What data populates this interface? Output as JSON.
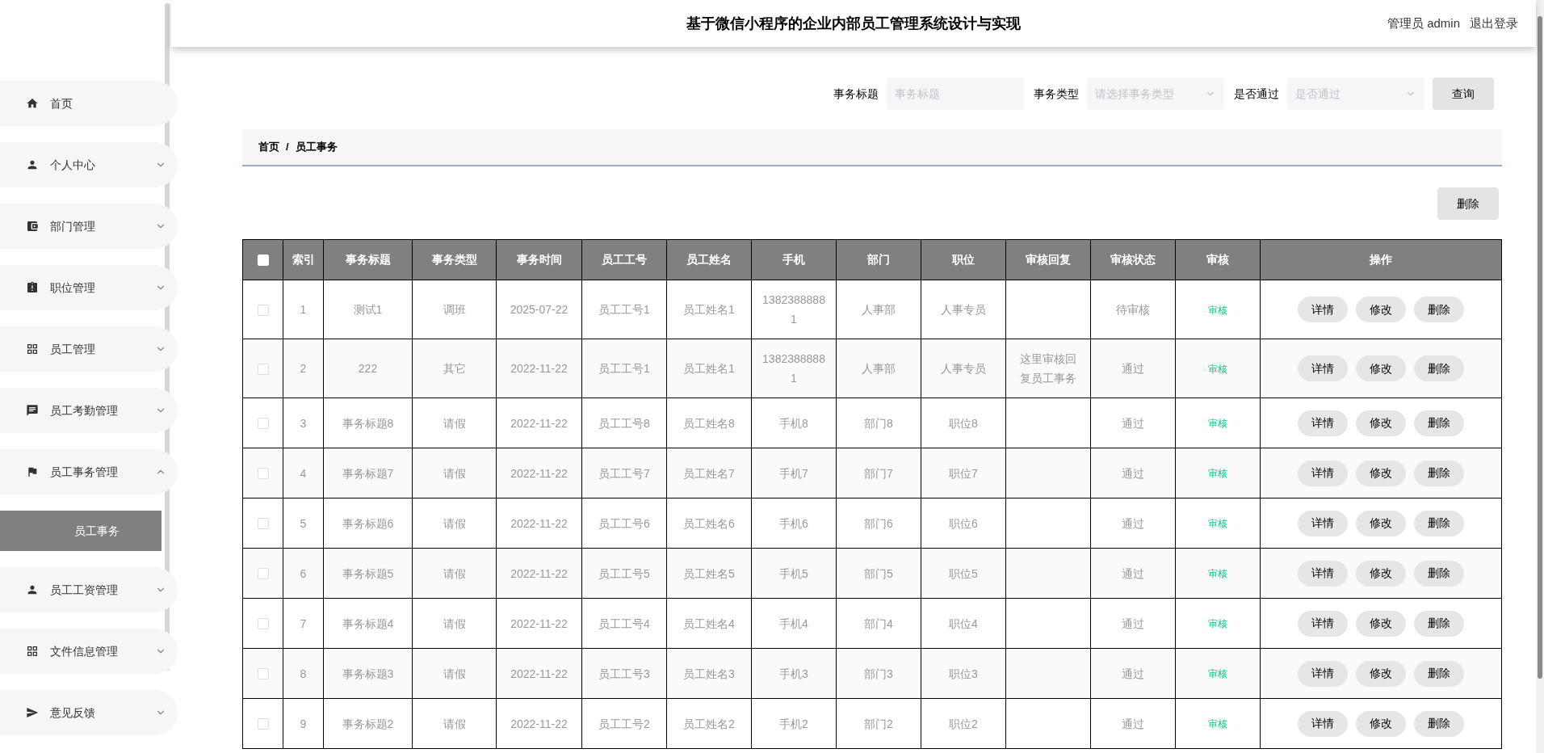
{
  "header": {
    "title": "基于微信小程序的企业内部员工管理系统设计与实现",
    "user": "管理员 admin",
    "logout": "退出登录"
  },
  "sidebar": {
    "items": [
      {
        "label": "首页",
        "kind": "link"
      },
      {
        "label": "个人中心",
        "kind": "menu",
        "expanded": false
      },
      {
        "label": "部门管理",
        "kind": "menu",
        "expanded": false
      },
      {
        "label": "职位管理",
        "kind": "menu",
        "expanded": false
      },
      {
        "label": "员工管理",
        "kind": "menu",
        "expanded": false
      },
      {
        "label": "员工考勤管理",
        "kind": "menu",
        "expanded": false
      },
      {
        "label": "员工事务管理",
        "kind": "menu",
        "expanded": true,
        "children": [
          {
            "label": "员工事务",
            "selected": true
          }
        ]
      },
      {
        "label": "员工工资管理",
        "kind": "menu",
        "expanded": false
      },
      {
        "label": "文件信息管理",
        "kind": "menu",
        "expanded": false
      },
      {
        "label": "意见反馈",
        "kind": "menu",
        "expanded": false
      }
    ]
  },
  "search": {
    "fields": [
      {
        "label": "事务标题",
        "kind": "input",
        "placeholder": "事务标题"
      },
      {
        "label": "事务类型",
        "kind": "select",
        "placeholder": "请选择事务类型"
      },
      {
        "label": "是否通过",
        "kind": "select",
        "placeholder": "是否通过"
      }
    ],
    "button": "查询"
  },
  "breadcrumb": {
    "items": [
      "首页",
      "员工事务"
    ],
    "separator": "/"
  },
  "delete_button": "删除",
  "table": {
    "header_checked": false,
    "columns": [
      "索引",
      "事务标题",
      "事务类型",
      "事务时间",
      "员工工号",
      "员工姓名",
      "手机",
      "部门",
      "职位",
      "审核回复",
      "审核状态",
      "审核",
      "操作"
    ],
    "rows": [
      {
        "checked": false,
        "cells": [
          "1",
          "测试1",
          "调班",
          "2025-07-22",
          "员工工号1",
          "员工姓名1",
          "13823888881",
          "人事部",
          "人事专员",
          "",
          "待审核"
        ],
        "review": "审核",
        "actions": [
          "详情",
          "修改",
          "删除"
        ]
      },
      {
        "checked": false,
        "cells": [
          "2",
          "222",
          "其它",
          "2022-11-22",
          "员工工号1",
          "员工姓名1",
          "13823888881",
          "人事部",
          "人事专员",
          "这里审核回复员工事务",
          "通过"
        ],
        "review": "审核",
        "actions": [
          "详情",
          "修改",
          "删除"
        ]
      },
      {
        "checked": false,
        "cells": [
          "3",
          "事务标题8",
          "请假",
          "2022-11-22",
          "员工工号8",
          "员工姓名8",
          "手机8",
          "部门8",
          "职位8",
          "",
          "通过"
        ],
        "review": "审核",
        "actions": [
          "详情",
          "修改",
          "删除"
        ]
      },
      {
        "checked": false,
        "cells": [
          "4",
          "事务标题7",
          "请假",
          "2022-11-22",
          "员工工号7",
          "员工姓名7",
          "手机7",
          "部门7",
          "职位7",
          "",
          "通过"
        ],
        "review": "审核",
        "actions": [
          "详情",
          "修改",
          "删除"
        ]
      },
      {
        "checked": false,
        "cells": [
          "5",
          "事务标题6",
          "请假",
          "2022-11-22",
          "员工工号6",
          "员工姓名6",
          "手机6",
          "部门6",
          "职位6",
          "",
          "通过"
        ],
        "review": "审核",
        "actions": [
          "详情",
          "修改",
          "删除"
        ]
      },
      {
        "checked": false,
        "cells": [
          "6",
          "事务标题5",
          "请假",
          "2022-11-22",
          "员工工号5",
          "员工姓名5",
          "手机5",
          "部门5",
          "职位5",
          "",
          "通过"
        ],
        "review": "审核",
        "actions": [
          "详情",
          "修改",
          "删除"
        ]
      },
      {
        "checked": false,
        "cells": [
          "7",
          "事务标题4",
          "请假",
          "2022-11-22",
          "员工工号4",
          "员工姓名4",
          "手机4",
          "部门4",
          "职位4",
          "",
          "通过"
        ],
        "review": "审核",
        "actions": [
          "详情",
          "修改",
          "删除"
        ]
      },
      {
        "checked": false,
        "cells": [
          "8",
          "事务标题3",
          "请假",
          "2022-11-22",
          "员工工号3",
          "员工姓名3",
          "手机3",
          "部门3",
          "职位3",
          "",
          "通过"
        ],
        "review": "审核",
        "actions": [
          "详情",
          "修改",
          "删除"
        ]
      },
      {
        "checked": false,
        "cells": [
          "9",
          "事务标题2",
          "请假",
          "2022-11-22",
          "员工工号2",
          "员工姓名2",
          "手机2",
          "部门2",
          "职位2",
          "",
          "通过"
        ],
        "review": "审核",
        "actions": [
          "详情",
          "修改",
          "删除"
        ]
      }
    ]
  }
}
